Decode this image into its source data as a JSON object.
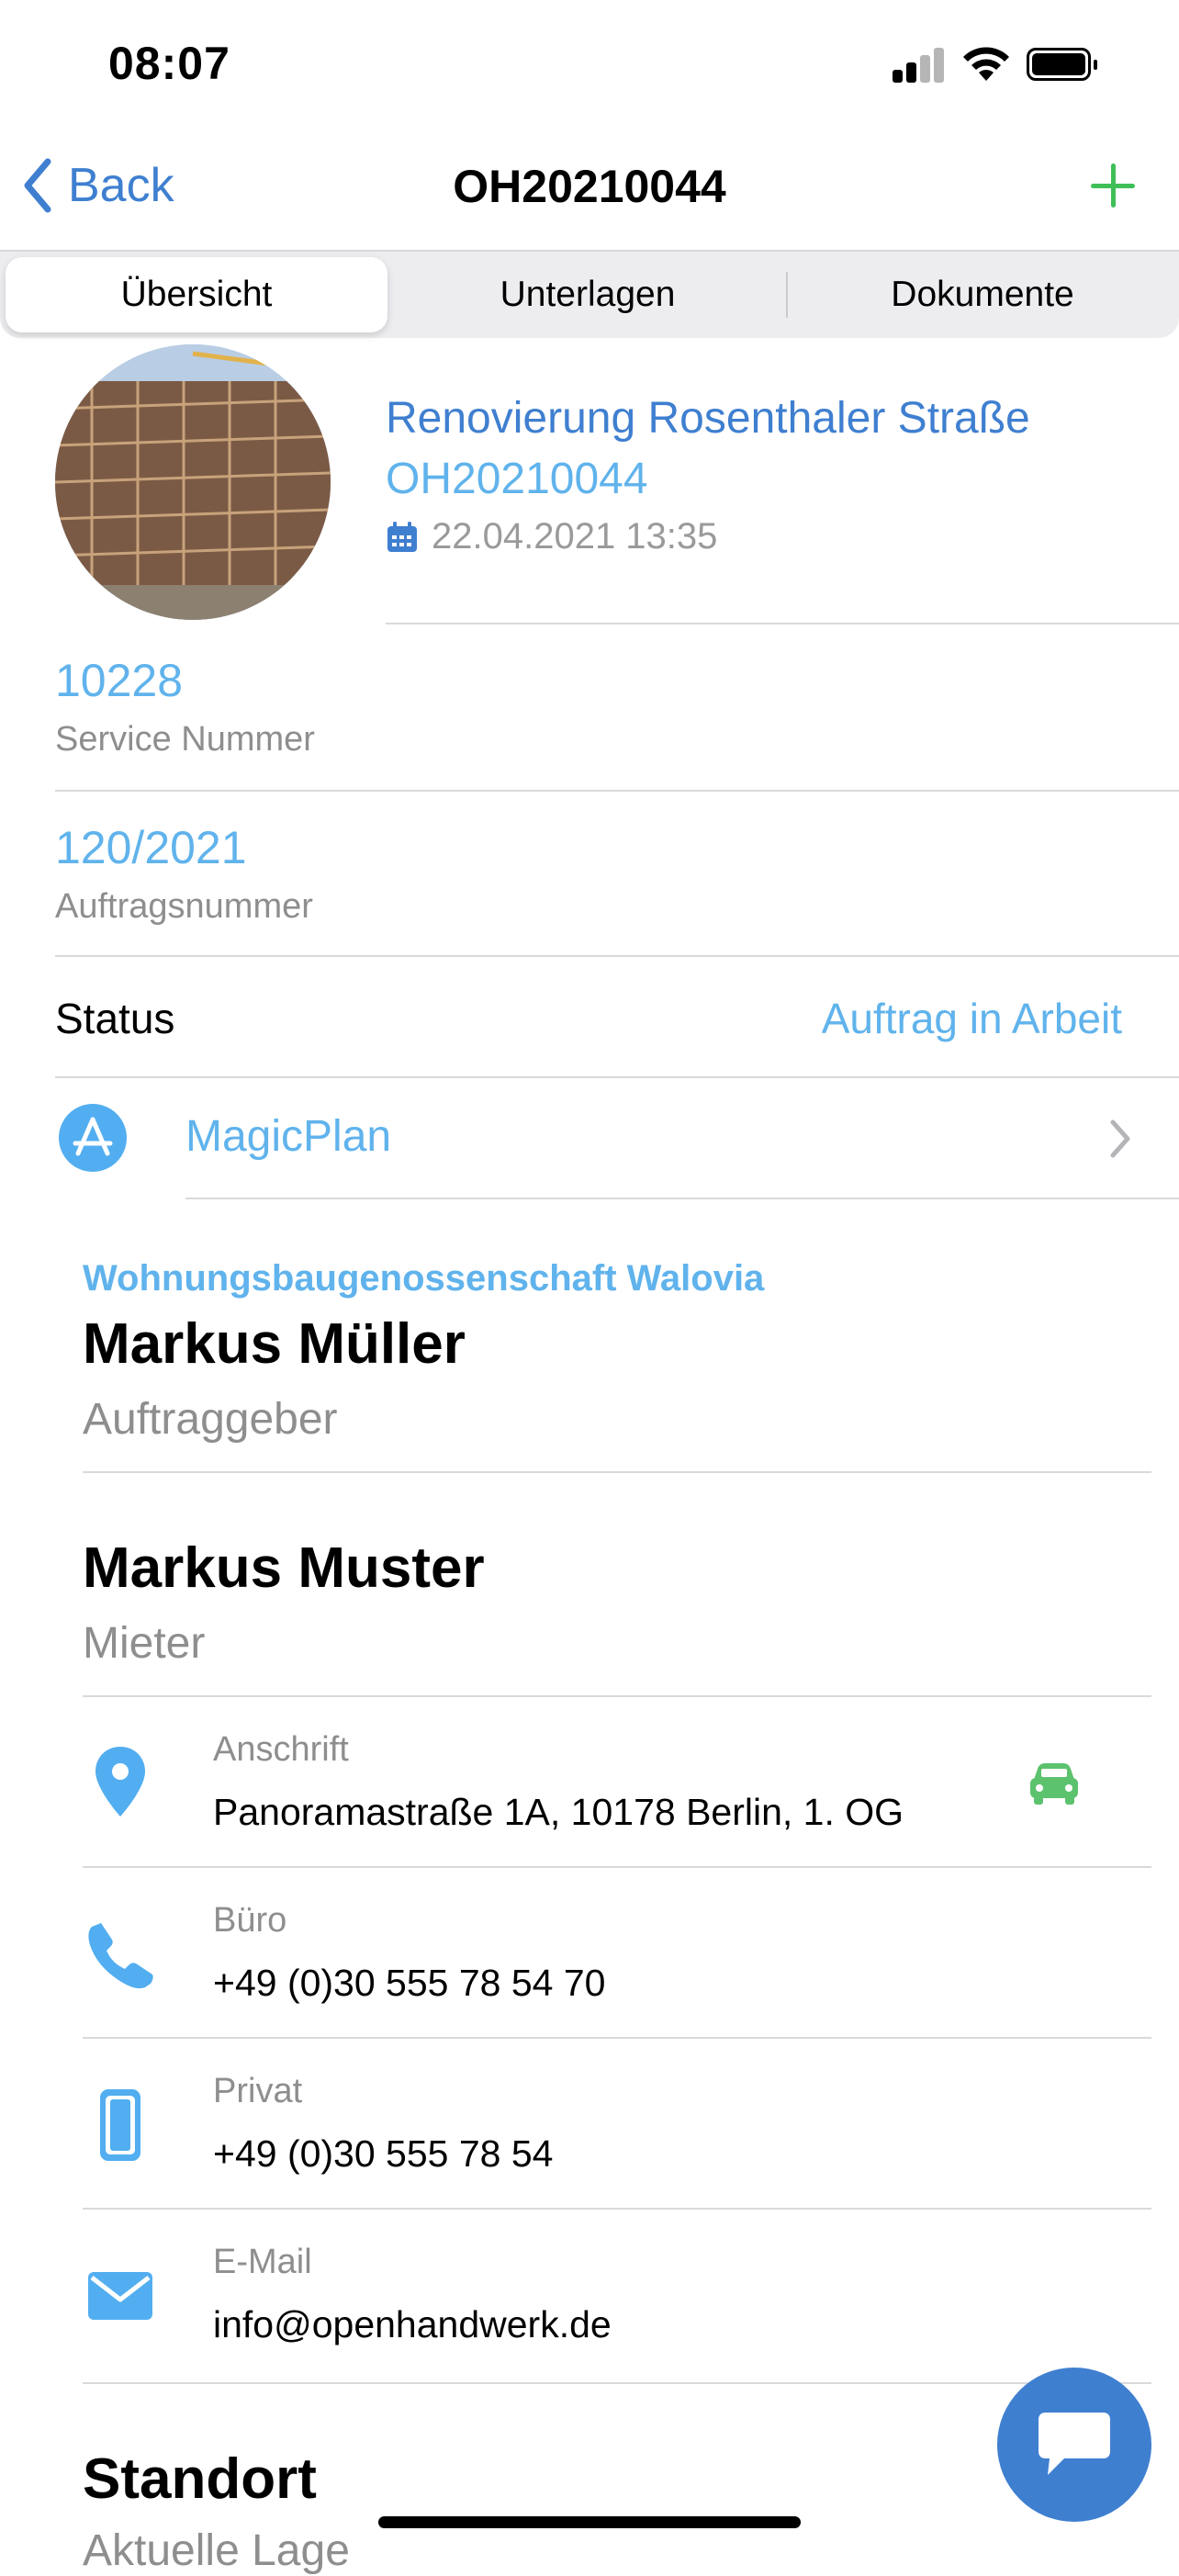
{
  "status_bar": {
    "time": "08:07"
  },
  "nav": {
    "back_label": "Back",
    "title": "OH20210044"
  },
  "tabs": [
    {
      "label": "Übersicht",
      "active": true
    },
    {
      "label": "Unterlagen",
      "active": false
    },
    {
      "label": "Dokumente",
      "active": false
    }
  ],
  "header": {
    "title": "Renovierung Rosenthaler Straße",
    "order_id": "OH20210044",
    "date": "22.04.2021 13:35"
  },
  "fields": [
    {
      "value": "10228",
      "label": "Service Nummer"
    },
    {
      "value": "120/2021",
      "label": "Auftragsnummer"
    }
  ],
  "status": {
    "label": "Status",
    "value": "Auftrag in Arbeit"
  },
  "app_link": {
    "label": "MagicPlan"
  },
  "client": {
    "company": "Wohnungsbaugenossenschaft Walovia",
    "name": "Markus Müller",
    "role": "Auftraggeber"
  },
  "tenant": {
    "name": "Markus Muster",
    "role": "Mieter",
    "contacts": [
      {
        "icon": "location-pin-icon",
        "label": "Anschrift",
        "value": "Panoramastraße 1A, 10178 Berlin, 1. OG"
      },
      {
        "icon": "phone-icon",
        "label": "Büro",
        "value": "+49 (0)30 555 78 54 70"
      },
      {
        "icon": "mobile-phone-icon",
        "label": "Privat",
        "value": "+49 (0)30 555 78 54"
      },
      {
        "icon": "mail-icon",
        "label": "E-Mail",
        "value": "info@openhandwerk.de"
      }
    ]
  },
  "location": {
    "title": "Standort",
    "subtitle": "Aktuelle Lage"
  },
  "colors": {
    "accent_blue": "#3f7fd0",
    "light_blue": "#60b3ec",
    "green": "#3fbf57"
  }
}
